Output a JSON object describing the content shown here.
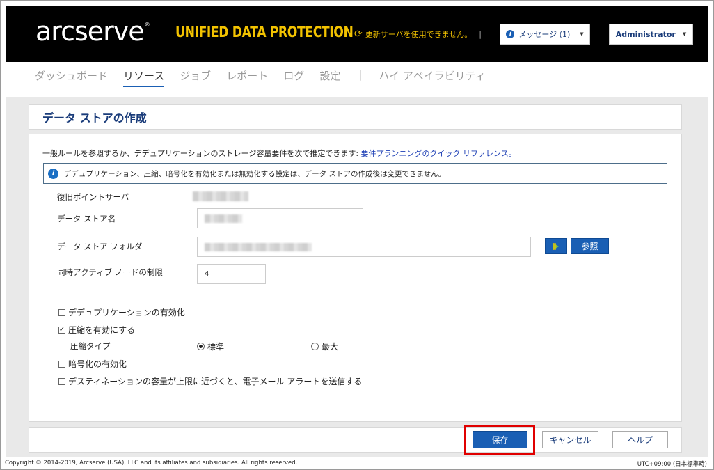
{
  "header": {
    "logo_text": "arcserve",
    "logo_mark": "®",
    "product_name": "UNIFIED DATA PROTECTION",
    "update_status": "更新サーバを使用できません。",
    "messages_label": "メッセージ (1)",
    "user_label": "Administrator"
  },
  "nav": {
    "items": [
      "ダッシュボード",
      "リソース",
      "ジョブ",
      "レポート",
      "ログ",
      "設定"
    ],
    "divider": "|",
    "ha": "ハイ アベイラビリティ"
  },
  "page": {
    "title": "データ ストアの作成"
  },
  "form": {
    "intro_text": "一般ルールを参照するか、デデュプリケーションのストレージ容量要件を次で推定できます: ",
    "intro_link": "要件プランニングのクイック リファレンス。",
    "notice": "デデュプリケーション、圧縮、暗号化を有効化または無効化する設定は、データ ストアの作成後は変更できません。",
    "rps_label": "復旧ポイントサーバ",
    "name_label": "データ ストア名",
    "folder_label": "データ ストア フォルダ",
    "browse_label": "参照",
    "concurrent_label": "同時アクティブ ノードの制限",
    "concurrent_value": "4",
    "dedup_label": "デデュプリケーションの有効化",
    "dedup_checked": false,
    "compress_label": "圧縮を有効にする",
    "compress_checked": true,
    "compress_type_label": "圧縮タイプ",
    "compress_standard": "標準",
    "compress_max": "最大",
    "compress_selected": "標準",
    "encrypt_label": "暗号化の有効化",
    "encrypt_checked": false,
    "alert_label": "デスティネーションの容量が上限に近づくと、電子メール アラートを送信する",
    "alert_checked": false
  },
  "footer": {
    "save": "保存",
    "cancel": "キャンセル",
    "help": "ヘルプ",
    "copyright": "Copyright © 2014-2019, Arcserve (USA), LLC and its affiliates and subsidiaries. All rights reserved.",
    "timezone": "UTC+09:00 (日本標準時)"
  },
  "colors": {
    "accent": "#1a5fb4",
    "brand_yellow": "#f2c200",
    "highlight": "#e00000"
  }
}
